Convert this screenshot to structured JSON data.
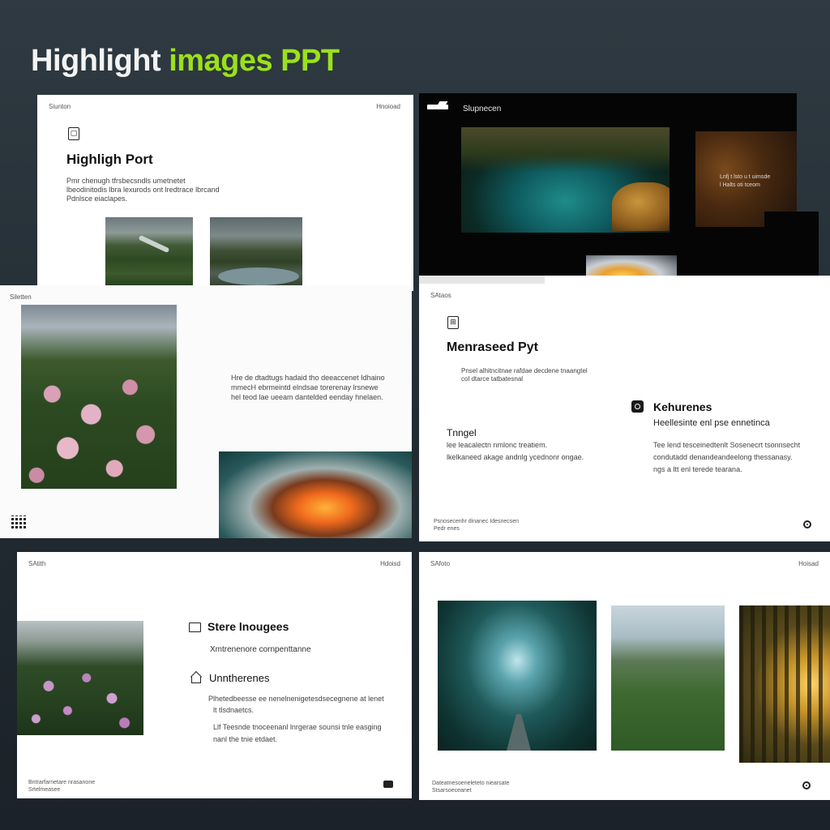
{
  "header": {
    "title_white": "Highlight ",
    "title_green": "images PPT"
  },
  "colors": {
    "background": "#27313a",
    "accent": "#9be11a"
  },
  "slide1": {
    "corner_left": "Siunton",
    "corner_right": "Hnoioad",
    "heading": "Highligh Port",
    "body_lines": [
      "Pmr chenugh tfrsbecsndls umetnetet",
      "lbeodinitodis lbra lexurods ont lredtrace lbrcand",
      "Pdnlsce eiaclapes."
    ]
  },
  "slide2": {
    "logo": "logo-icon",
    "heading": "Slupnecen",
    "caption_lines": [
      "Lnfj t lsto u t uimsde",
      "l Halts oti tceom"
    ]
  },
  "slide3": {
    "corner_left": "Siletten",
    "body_lines": [
      "Hre de dtadtugs hadaid tho deeaccenet Idhaino",
      "mmecH ebrmeintd elndsae torerenay lrsnewe",
      "hel teod lae ueeam dantelded eenday hnelaen."
    ],
    "footer_icon": "qr-icon"
  },
  "slide4": {
    "corner_left": "SAtaos",
    "heading": "Menraseed Pyt",
    "sub_lines": [
      "Pnsel alhitncitnae rafdae decdene tnaangtel",
      "col dtarce tatbatesnal"
    ],
    "left_title": "Tnngel",
    "left_lines": [
      "lee leacalectn nmlonc treatiem.",
      "lkelkaneed akage andnlg ycednonr ongae."
    ],
    "right_title": "Kehurenes",
    "right_sub": "Heellesinte enl pse ennetinca",
    "right_lines": [
      "Tee lend tesceinedtenlt Sosenecrt tsonnsecht",
      "condutadd denandeandeelong thessanasy.",
      "ngs a ltt enl terede tearana."
    ],
    "footer_lines": [
      "Psnosecenhr dinanec Idesnecsen",
      "Pedr enes"
    ]
  },
  "slide5": {
    "corner_left": "SAtith",
    "corner_right": "Hdoisd",
    "heading1": "Stere lnougees",
    "sub1": "Xmtrenenore cornpenttanne",
    "heading2": "Unntherenes",
    "lines_a": [
      "Plhetedbeesse ee nenelnenigetesdsecegnene at lenet",
      "lt tlsdnaetcs."
    ],
    "lines_b": [
      "Llf Teesnde tnoceenanl lnrgerae sounsi tnle easging",
      "nanl the tnie etdaet."
    ],
    "footer_lines": [
      "Bntrarfarnetare nrasanone",
      "Srtelmeasee"
    ]
  },
  "slide6": {
    "corner_left": "SAfoto",
    "corner_right": "Hoisad",
    "footer_lines": [
      "Dateatnesoeneleteto niearsate",
      "Stsarsoeceanet"
    ]
  }
}
